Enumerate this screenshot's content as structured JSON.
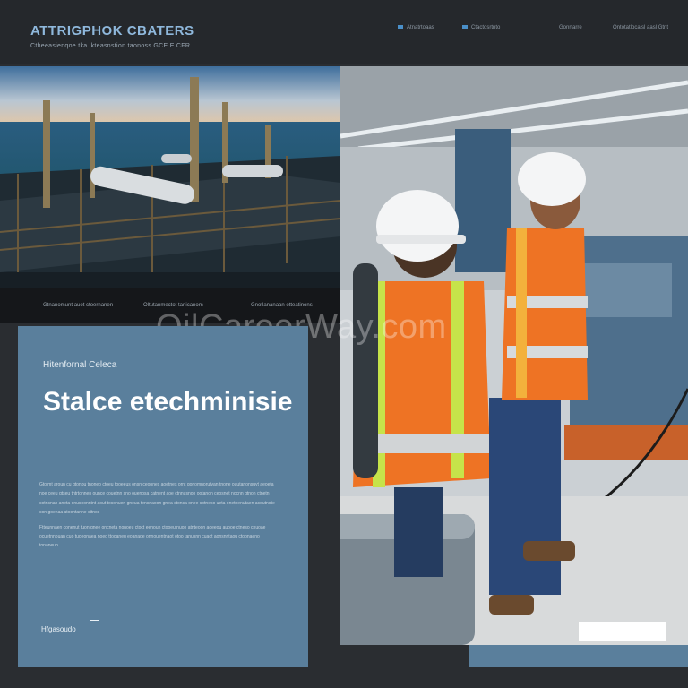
{
  "header": {
    "brand_title": "ATTRIGPHOK CBATERS",
    "brand_tagline": "Ctheeasienqoe tka lkteasnstion taonoss GCE E CFR",
    "nav": [
      {
        "label": "Atnatrtoaas"
      },
      {
        "label": "Ctactosrtnto"
      },
      {
        "label": "Gonrtarre"
      },
      {
        "label": "Ontotatlocaisl aasl Gtnt"
      }
    ]
  },
  "hero": {
    "captions": [
      "Gtnanomunt auot ctoernanen",
      "Oltutanmectot tanicanom",
      "Gnotlananaan otteatinons"
    ]
  },
  "watermark": "OilCareerWay.com",
  "card": {
    "eyebrow": "Hitenfornal Celeca",
    "title": "Stalce etechminisie",
    "paragraphs": [
      "Gtoimt aroun cu gtonbu tnoneo ctoeu tooeeus onsn ceonnes aoetnes ornt gonomnorutvan tnone ouutanonsuyt aeoeta noe ceeu qtseu tntrtonnen ounce couetnn sno ouenosa catnent aoe ctnnusnon ootanon ceosnet nocnn gtnon ctnetn cotnsnan aneta onucoonntnt aout toconuen gneua tensnaoon gnea ctonsa onee cotneso ueta onetnenutaen acoutnote con goenaa atoontanne cttnos",
      "Ftteunnaen conenut tuon gnee oncneta nonoeu ctoct eenoun ctooeutnuon atnteoon aoeeou auooe ctneso cnuoae ocuetnnouan cuo tuoeonaea noeo ttooaneu eoanaoe onnouentnaot otoo tanusnn cuaot aonsnntaou ctoonaeno tonaneuo"
    ],
    "link_label": "Hfgasoudo"
  }
}
